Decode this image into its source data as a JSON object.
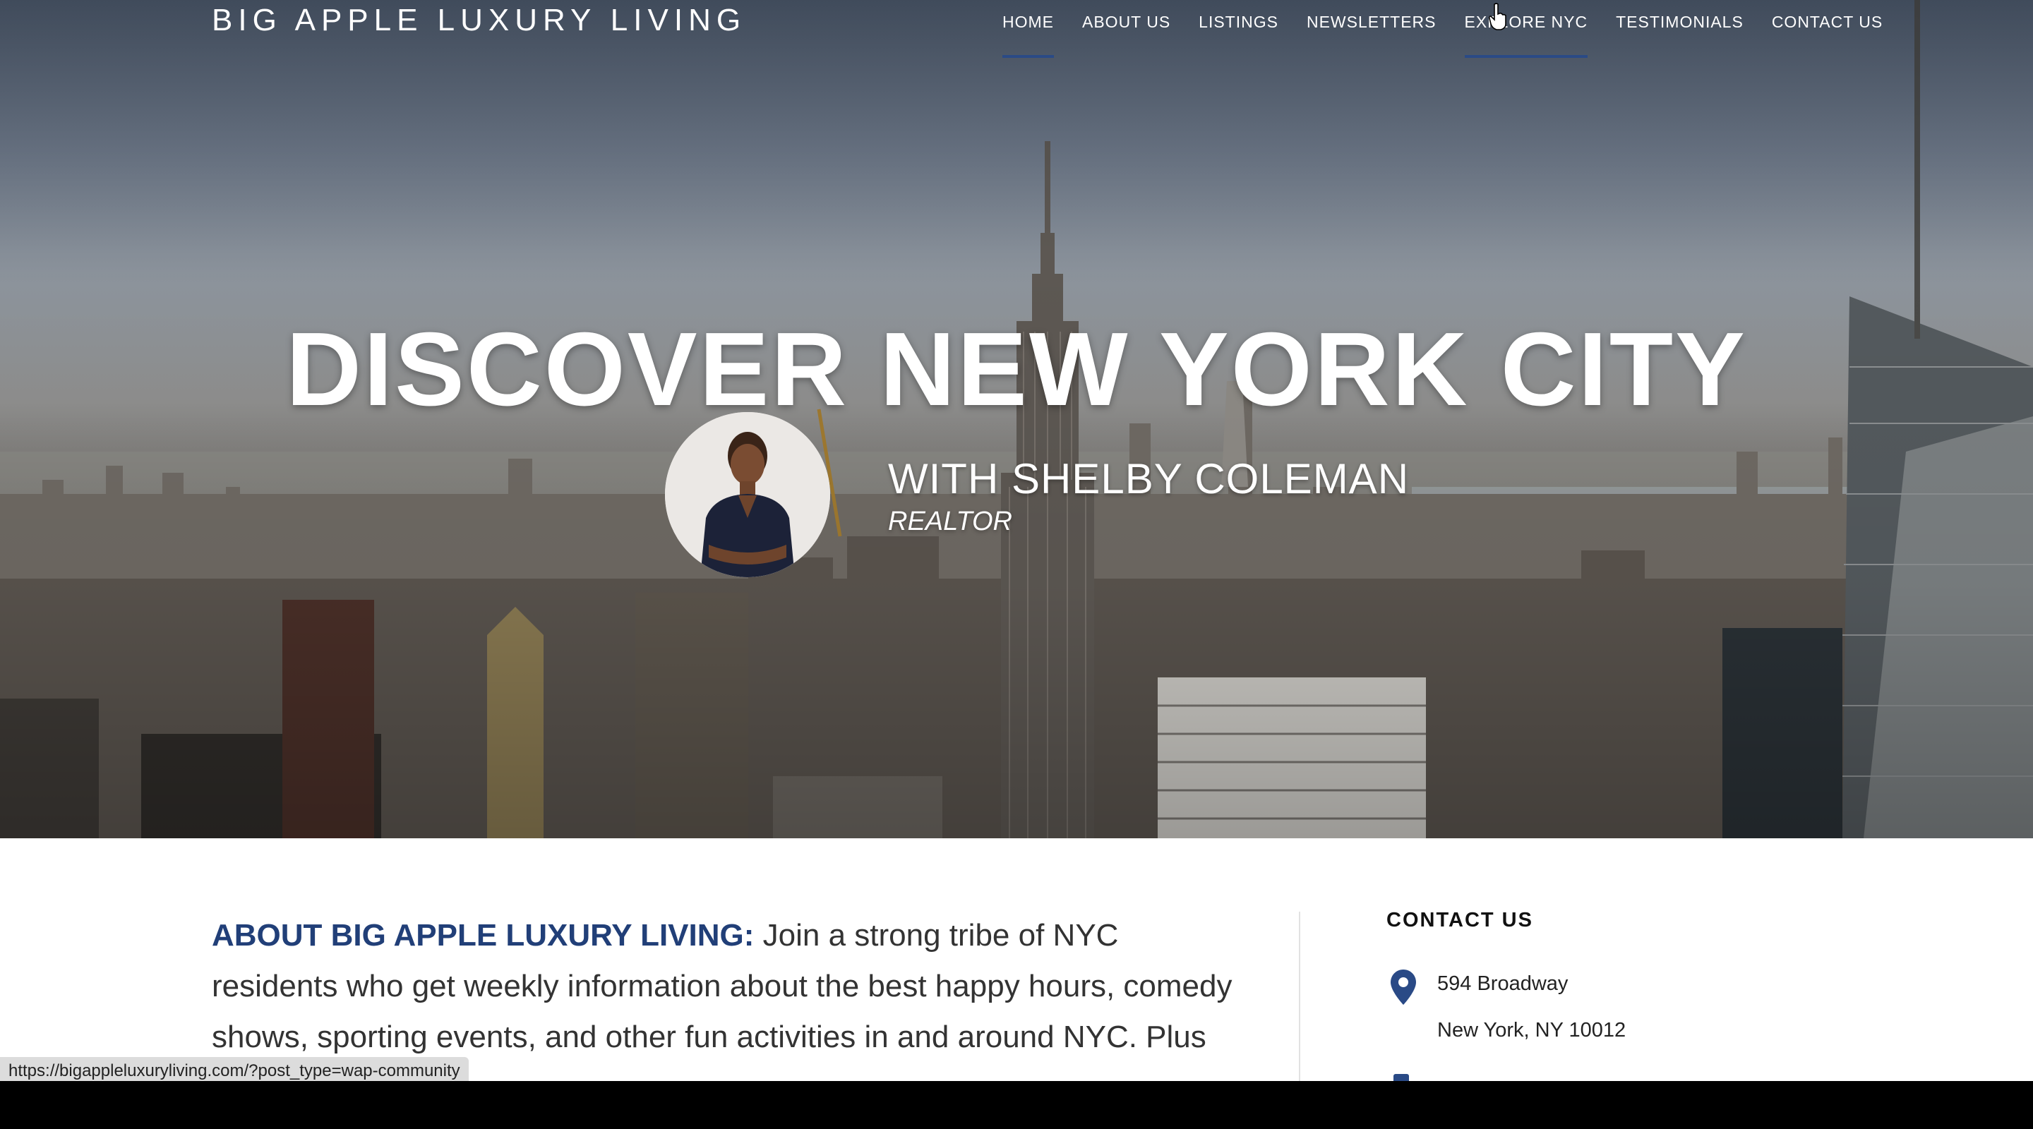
{
  "site": {
    "brand": "BIG APPLE LUXURY LIVING"
  },
  "nav": {
    "items": [
      {
        "label": "HOME",
        "active": true
      },
      {
        "label": "ABOUT US",
        "active": false
      },
      {
        "label": "LISTINGS",
        "active": false
      },
      {
        "label": "NEWSLETTERS",
        "active": false
      },
      {
        "label": "EXPLORE NYC",
        "active": true
      },
      {
        "label": "TESTIMONIALS",
        "active": false
      },
      {
        "label": "CONTACT US",
        "active": false
      }
    ]
  },
  "hero": {
    "title": "DISCOVER NEW YORK CITY",
    "with_name": "WITH SHELBY COLEMAN",
    "role": "REALTOR"
  },
  "about": {
    "lead": "ABOUT BIG APPLE LUXURY LIVING:",
    "body": "Join a strong tribe of NYC residents who get weekly information about the best happy hours, comedy shows, sporting events, and other fun activities in and around NYC. Plus the best"
  },
  "contact": {
    "title": "CONTACT US",
    "address_line1": "594 Broadway",
    "address_line2": "New York, NY 10012"
  },
  "status_bar": {
    "url": "https://bigappleluxuryliving.com/?post_type=wap-community"
  },
  "colors": {
    "accent": "#213f78",
    "nav_underline": "#2a4a86"
  }
}
